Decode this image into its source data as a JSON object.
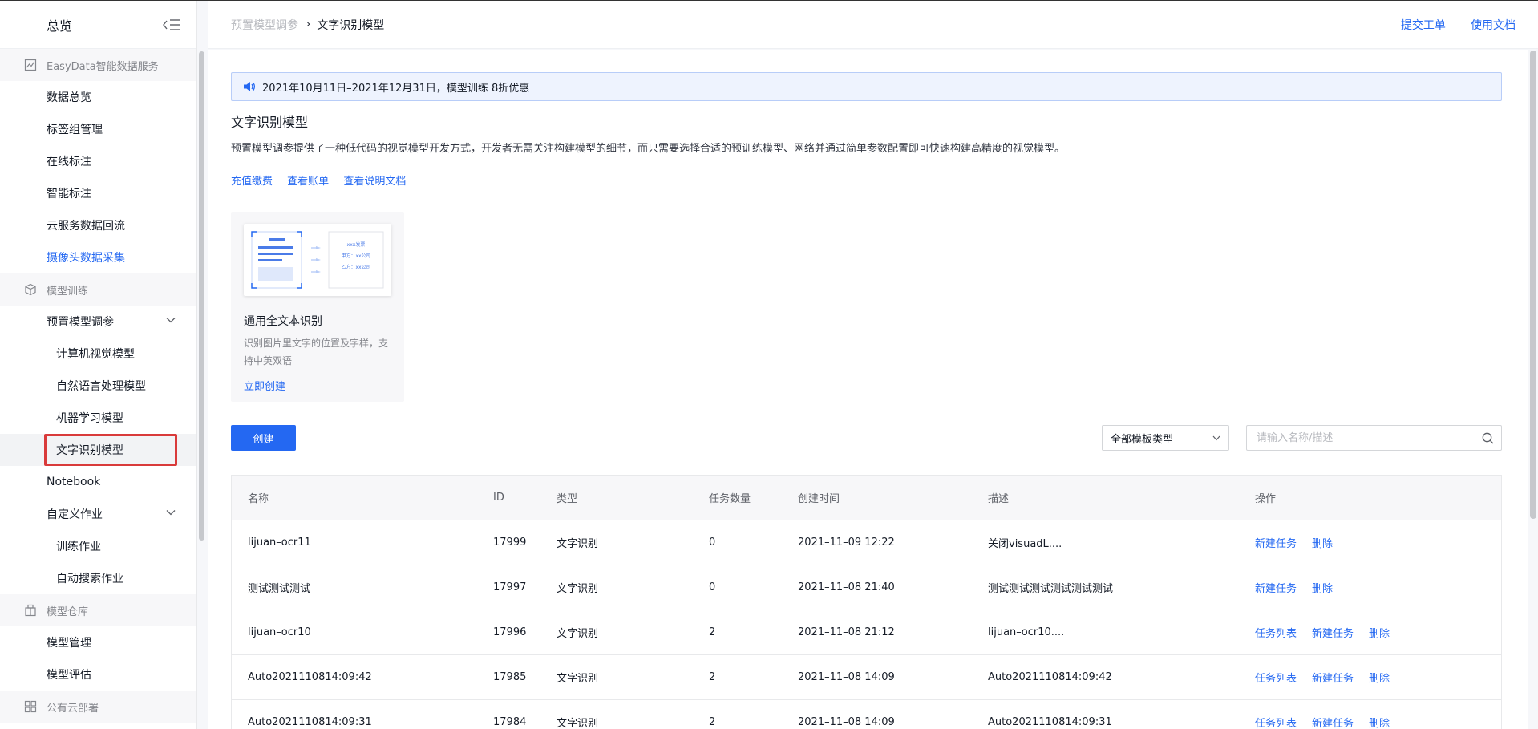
{
  "sidebar": {
    "title": "总览",
    "groups": [
      {
        "label": "EasyData智能数据服务",
        "icon": "chart-icon",
        "items": [
          {
            "label": "数据总览"
          },
          {
            "label": "标签组管理"
          },
          {
            "label": "在线标注"
          },
          {
            "label": "智能标注"
          },
          {
            "label": "云服务数据回流"
          },
          {
            "label": "摄像头数据采集"
          }
        ]
      },
      {
        "label": "模型训练",
        "icon": "cube-icon",
        "items": [
          {
            "label": "预置模型调参",
            "expanded": true,
            "children": [
              {
                "label": "计算机视觉模型"
              },
              {
                "label": "自然语言处理模型"
              },
              {
                "label": "机器学习模型"
              },
              {
                "label": "文字识别模型",
                "active": true
              }
            ]
          },
          {
            "label": "Notebook"
          },
          {
            "label": "自定义作业",
            "expanded": true,
            "children": [
              {
                "label": "训练作业"
              },
              {
                "label": "自动搜索作业"
              }
            ]
          }
        ]
      },
      {
        "label": "模型仓库",
        "icon": "warehouse-icon",
        "items": [
          {
            "label": "模型管理"
          },
          {
            "label": "模型评估"
          }
        ]
      },
      {
        "label": "公有云部署",
        "icon": "deploy-icon",
        "items": []
      }
    ]
  },
  "header": {
    "breadcrumb_parent": "预置模型调参",
    "breadcrumb_current": "文字识别模型",
    "links": [
      "提交工单",
      "使用文档"
    ]
  },
  "notice": "2021年10月11日–2021年12月31日，模型训练 8折优惠",
  "page": {
    "title": "文字识别模型",
    "description": "预置模型调参提供了一种低代码的视觉模型开发方式，开发者无需关注构建模型的细节，而只需要选择合适的预训练模型、网络并通过简单参数配置即可快速构建高精度的视觉模型。",
    "links": [
      "充值缴费",
      "查看账单",
      "查看说明文档"
    ]
  },
  "card": {
    "title": "通用全文本识别",
    "description": "识别图片里文字的位置及字样，支持中英双语",
    "action": "立即创建",
    "img_lines": [
      "xxx发票",
      "甲方：xx公司",
      "乙方：xx公司"
    ]
  },
  "toolbar": {
    "create_label": "创建",
    "filter_value": "全部模板类型",
    "search_placeholder": "请输入名称/描述"
  },
  "table": {
    "columns": [
      "名称",
      "ID",
      "类型",
      "任务数量",
      "创建时间",
      "描述",
      "操作"
    ],
    "rows": [
      {
        "name": "lijuan–ocr11",
        "id": "17999",
        "type": "文字识别",
        "count": "0",
        "time": "2021–11–09  12:22",
        "desc": "关闭visuadL....",
        "ops": [
          "新建任务",
          "删除"
        ]
      },
      {
        "name": "测试测试测试",
        "id": "17997",
        "type": "文字识别",
        "count": "0",
        "time": "2021–11–08  21:40",
        "desc": "测试测试测试测试测试测试",
        "ops": [
          "新建任务",
          "删除"
        ]
      },
      {
        "name": "lijuan–ocr10",
        "id": "17996",
        "type": "文字识别",
        "count": "2",
        "time": "2021–11–08  21:12",
        "desc": "lijuan–ocr10....",
        "ops": [
          "任务列表",
          "新建任务",
          "删除"
        ]
      },
      {
        "name": "Auto2021110814:09:42",
        "id": "17985",
        "type": "文字识别",
        "count": "2",
        "time": "2021–11–08  14:09",
        "desc": "Auto2021110814:09:42",
        "ops": [
          "任务列表",
          "新建任务",
          "删除"
        ]
      },
      {
        "name": "Auto2021110814:09:31",
        "id": "17984",
        "type": "文字识别",
        "count": "2",
        "time": "2021–11–08  14:09",
        "desc": "Auto2021110814:09:31",
        "ops": [
          "任务列表",
          "新建任务",
          "删除"
        ]
      }
    ]
  },
  "colors": {
    "accent": "#2468f2",
    "highlight": "#d93a3a"
  }
}
